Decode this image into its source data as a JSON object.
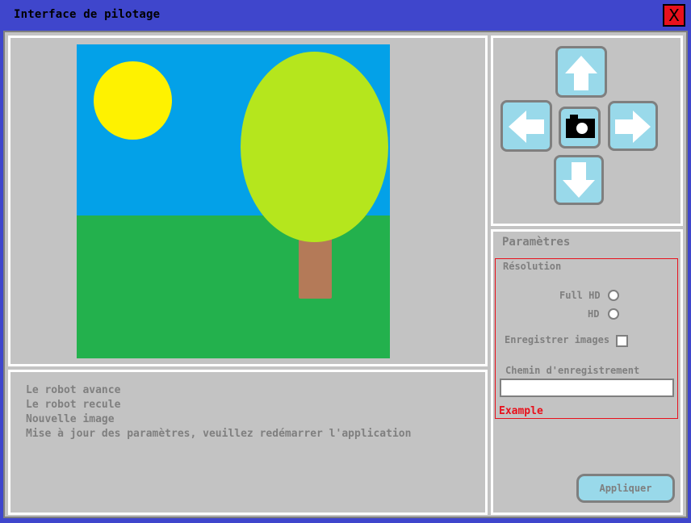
{
  "window": {
    "title": "Interface de pilotage",
    "close_label": "X"
  },
  "colors": {
    "titlebar": "#3f46cc",
    "panel_bg": "#c3c3c3",
    "button_bg": "#99d9ea",
    "accent_red": "#e8111c"
  },
  "image_preview": {
    "scene_elements": [
      "sky",
      "sun",
      "grass",
      "tree-crown",
      "tree-trunk"
    ]
  },
  "log": {
    "lines": [
      "Le robot avance",
      "Le robot recule",
      "Nouvelle image",
      "Mise à jour des paramètres, veuillez redémarrer l'application"
    ]
  },
  "navigation": {
    "buttons": [
      {
        "name": "up",
        "icon": "arrow-up-icon"
      },
      {
        "name": "left",
        "icon": "arrow-left-icon"
      },
      {
        "name": "capture",
        "icon": "camera-icon"
      },
      {
        "name": "right",
        "icon": "arrow-right-icon"
      },
      {
        "name": "down",
        "icon": "arrow-down-icon"
      }
    ]
  },
  "params": {
    "title": "Paramètres",
    "resolution_label": "Résolution",
    "resolution_options": [
      "Full HD",
      "HD"
    ],
    "save_images_label": "Enregistrer images",
    "save_images_checked": false,
    "path_label": "Chemin d'enregistrement",
    "path_value": "",
    "path_hint": "Example",
    "apply_label": "Appliquer"
  }
}
